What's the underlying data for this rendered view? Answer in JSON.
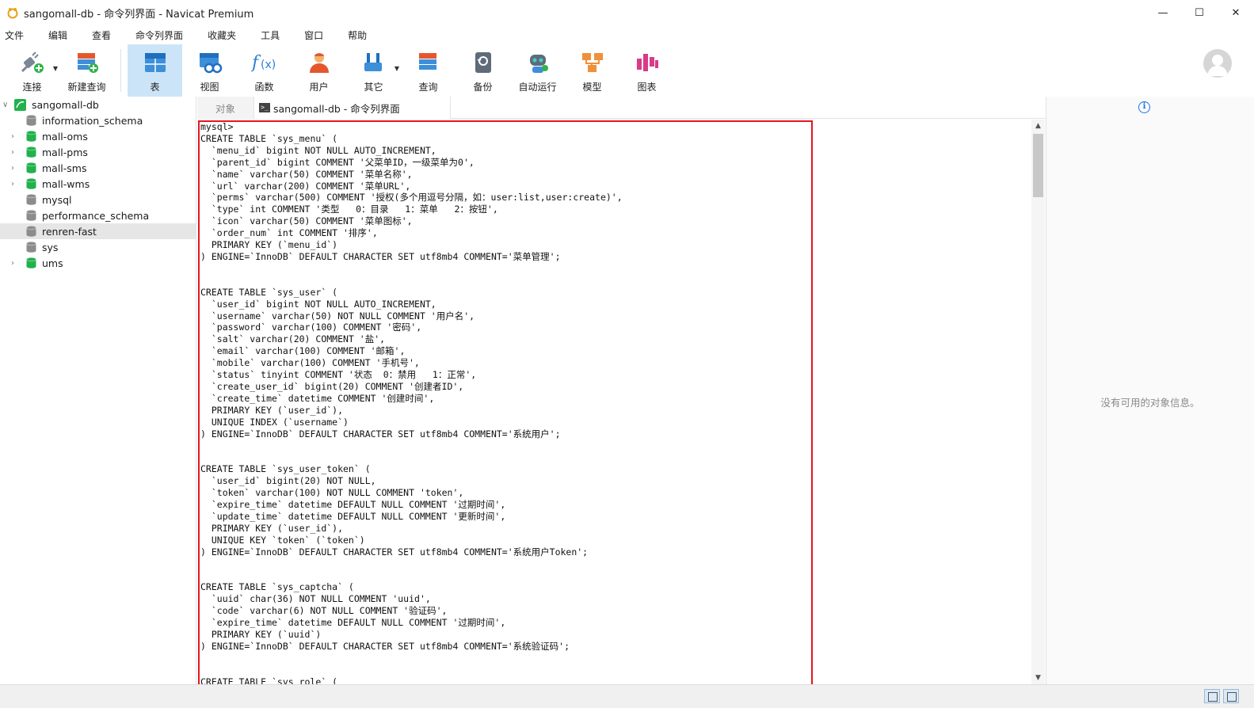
{
  "window": {
    "title": "sangomall-db - 命令列界面 - Navicat Premium",
    "controls": {
      "minimize": "—",
      "maximize": "☐",
      "close": "✕"
    }
  },
  "menu": [
    "文件",
    "编辑",
    "查看",
    "命令列界面",
    "收藏夹",
    "工具",
    "窗口",
    "帮助"
  ],
  "toolbar": [
    {
      "label": "连接",
      "icon": "plug-icon",
      "dropdown": true
    },
    {
      "label": "新建查询",
      "icon": "new-query-icon",
      "dropdown": false
    },
    {
      "label": "表",
      "icon": "table-icon",
      "dropdown": false,
      "active": true
    },
    {
      "label": "视图",
      "icon": "view-icon",
      "dropdown": false
    },
    {
      "label": "函数",
      "icon": "function-icon",
      "dropdown": false
    },
    {
      "label": "用户",
      "icon": "user-icon",
      "dropdown": false
    },
    {
      "label": "其它",
      "icon": "tools-icon",
      "dropdown": true
    },
    {
      "label": "查询",
      "icon": "query-icon",
      "dropdown": false
    },
    {
      "label": "备份",
      "icon": "backup-icon",
      "dropdown": false
    },
    {
      "label": "自动运行",
      "icon": "robot-icon",
      "dropdown": false
    },
    {
      "label": "模型",
      "icon": "model-icon",
      "dropdown": false
    },
    {
      "label": "图表",
      "icon": "chart-icon",
      "dropdown": false
    }
  ],
  "tree": {
    "root": "sangomall-db",
    "databases": [
      {
        "name": "information_schema",
        "expandable": false,
        "color": "#8c8c8c"
      },
      {
        "name": "mall-oms",
        "expandable": true,
        "color": "#21b24b"
      },
      {
        "name": "mall-pms",
        "expandable": true,
        "color": "#21b24b"
      },
      {
        "name": "mall-sms",
        "expandable": true,
        "color": "#21b24b"
      },
      {
        "name": "mall-wms",
        "expandable": true,
        "color": "#21b24b"
      },
      {
        "name": "mysql",
        "expandable": false,
        "color": "#8c8c8c"
      },
      {
        "name": "performance_schema",
        "expandable": false,
        "color": "#8c8c8c"
      },
      {
        "name": "renren-fast",
        "expandable": false,
        "color": "#8c8c8c",
        "selected": true
      },
      {
        "name": "sys",
        "expandable": false,
        "color": "#8c8c8c"
      },
      {
        "name": "ums",
        "expandable": true,
        "color": "#21b24b"
      }
    ]
  },
  "tabs": {
    "objects": "对象",
    "console": "sangomall-db - 命令列界面"
  },
  "console_text": "mysql>\nCREATE TABLE `sys_menu` (\n  `menu_id` bigint NOT NULL AUTO_INCREMENT,\n  `parent_id` bigint COMMENT '父菜单ID，一级菜单为0',\n  `name` varchar(50) COMMENT '菜单名称',\n  `url` varchar(200) COMMENT '菜单URL',\n  `perms` varchar(500) COMMENT '授权(多个用逗号分隔，如：user:list,user:create)',\n  `type` int COMMENT '类型   0：目录   1：菜单   2：按钮',\n  `icon` varchar(50) COMMENT '菜单图标',\n  `order_num` int COMMENT '排序',\n  PRIMARY KEY (`menu_id`)\n) ENGINE=`InnoDB` DEFAULT CHARACTER SET utf8mb4 COMMENT='菜单管理';\n\n\nCREATE TABLE `sys_user` (\n  `user_id` bigint NOT NULL AUTO_INCREMENT,\n  `username` varchar(50) NOT NULL COMMENT '用户名',\n  `password` varchar(100) COMMENT '密码',\n  `salt` varchar(20) COMMENT '盐',\n  `email` varchar(100) COMMENT '邮箱',\n  `mobile` varchar(100) COMMENT '手机号',\n  `status` tinyint COMMENT '状态  0：禁用   1：正常',\n  `create_user_id` bigint(20) COMMENT '创建者ID',\n  `create_time` datetime COMMENT '创建时间',\n  PRIMARY KEY (`user_id`),\n  UNIQUE INDEX (`username`)\n) ENGINE=`InnoDB` DEFAULT CHARACTER SET utf8mb4 COMMENT='系统用户';\n\n\nCREATE TABLE `sys_user_token` (\n  `user_id` bigint(20) NOT NULL,\n  `token` varchar(100) NOT NULL COMMENT 'token',\n  `expire_time` datetime DEFAULT NULL COMMENT '过期时间',\n  `update_time` datetime DEFAULT NULL COMMENT '更新时间',\n  PRIMARY KEY (`user_id`),\n  UNIQUE KEY `token` (`token`)\n) ENGINE=`InnoDB` DEFAULT CHARACTER SET utf8mb4 COMMENT='系统用户Token';\n\n\nCREATE TABLE `sys_captcha` (\n  `uuid` char(36) NOT NULL COMMENT 'uuid',\n  `code` varchar(6) NOT NULL COMMENT '验证码',\n  `expire_time` datetime DEFAULT NULL COMMENT '过期时间',\n  PRIMARY KEY (`uuid`)\n) ENGINE=`InnoDB` DEFAULT CHARACTER SET utf8mb4 COMMENT='系统验证码';\n\n\nCREATE TABLE `sys_role` (",
  "info_panel": {
    "message": "没有可用的对象信息。"
  },
  "colors": {
    "accent": "#cce4f7",
    "highlight_border": "#e8141e",
    "info_blue": "#1a73e8"
  }
}
